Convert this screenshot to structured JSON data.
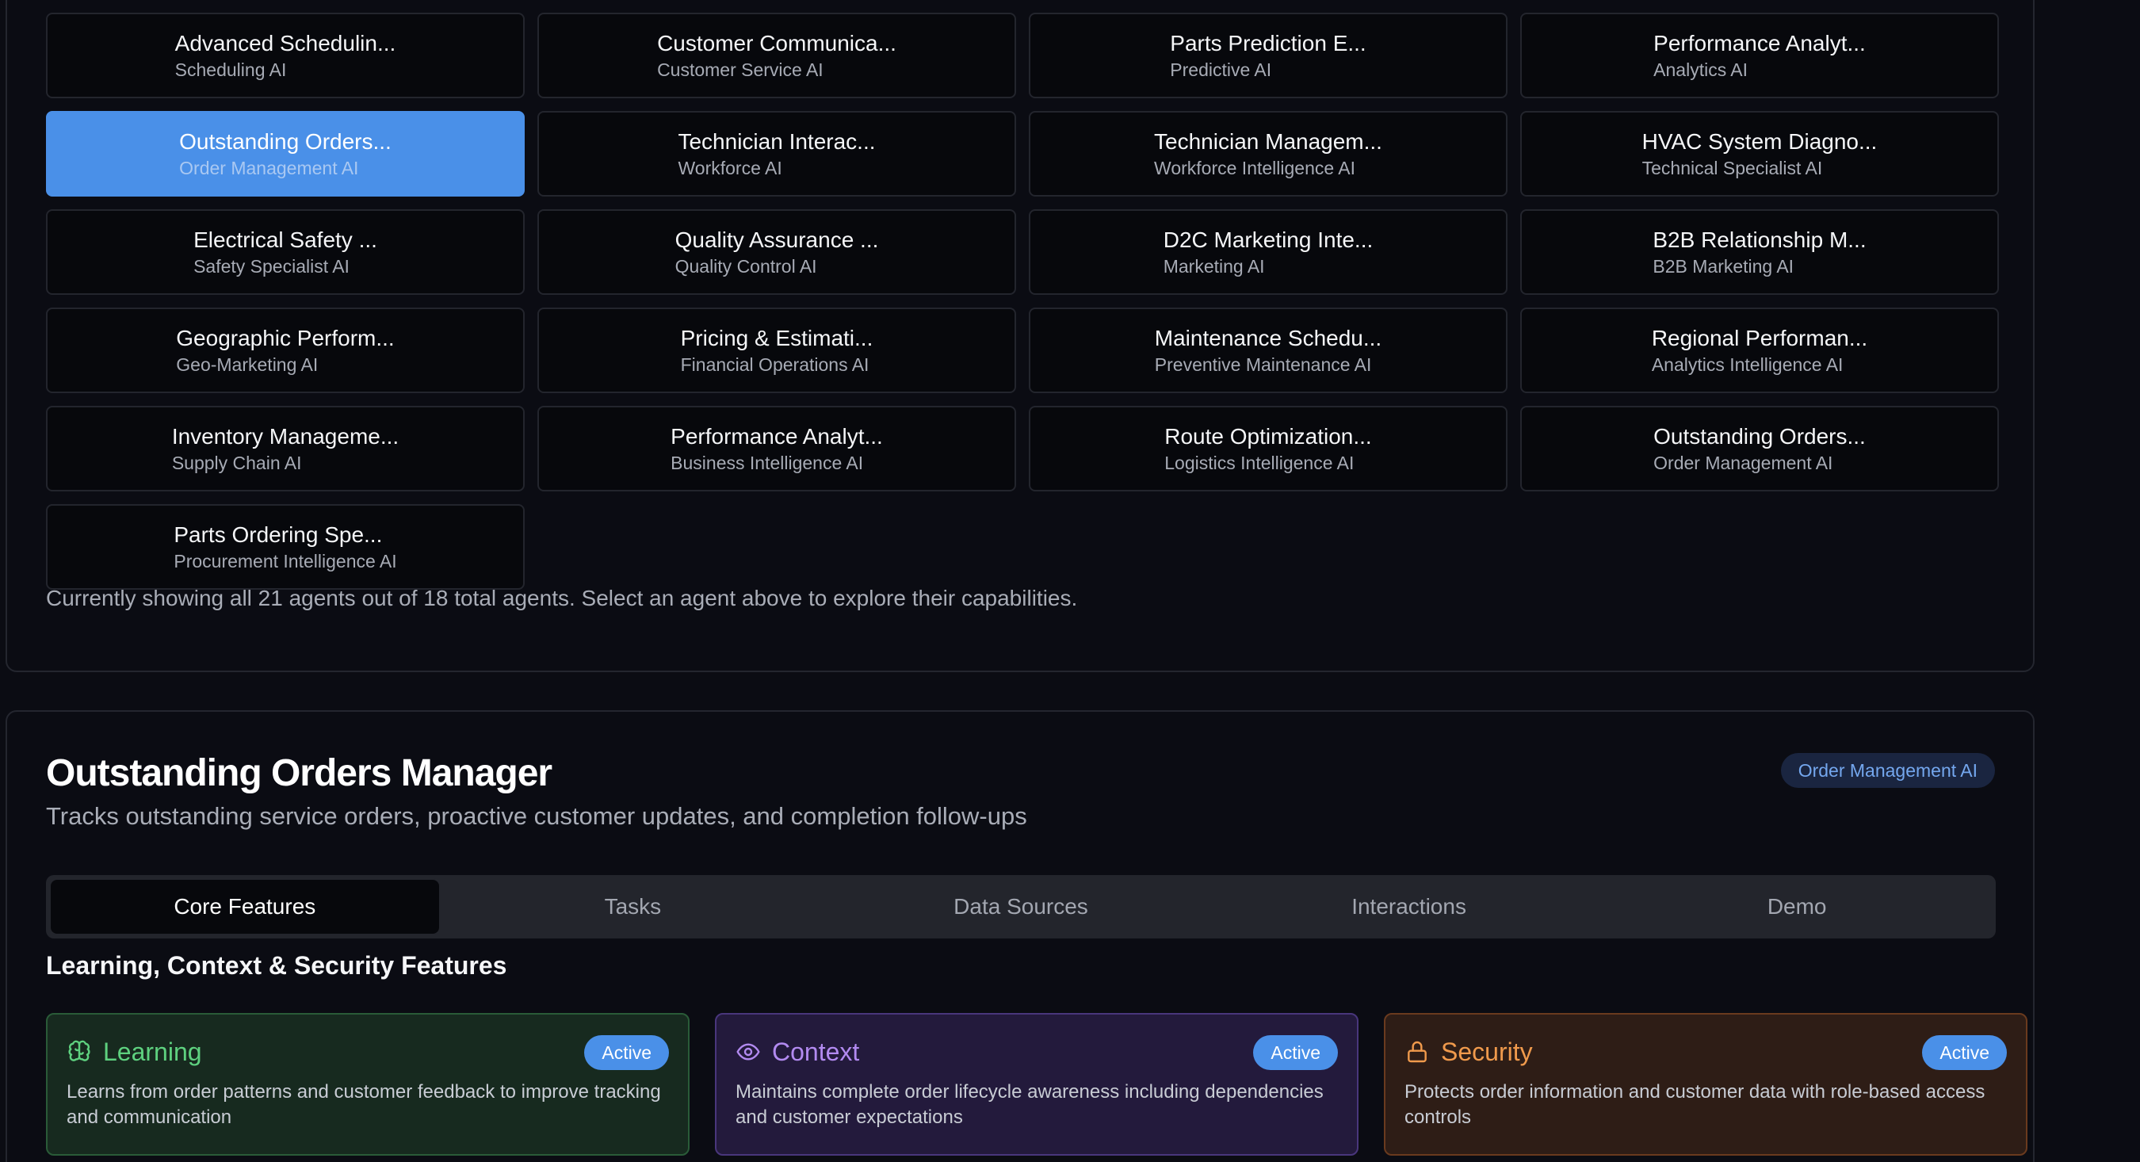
{
  "agents": [
    {
      "title": "Advanced Schedulin...",
      "subtitle": "Scheduling AI"
    },
    {
      "title": "Customer Communica...",
      "subtitle": "Customer Service AI"
    },
    {
      "title": "Parts Prediction E...",
      "subtitle": "Predictive AI"
    },
    {
      "title": "Performance Analyt...",
      "subtitle": "Analytics AI"
    },
    {
      "title": "Outstanding Orders...",
      "subtitle": "Order Management AI",
      "selected": true
    },
    {
      "title": "Technician Interac...",
      "subtitle": "Workforce AI"
    },
    {
      "title": "Technician Managem...",
      "subtitle": "Workforce Intelligence AI"
    },
    {
      "title": "HVAC System Diagno...",
      "subtitle": "Technical Specialist AI"
    },
    {
      "title": "Electrical Safety ...",
      "subtitle": "Safety Specialist AI"
    },
    {
      "title": "Quality Assurance ...",
      "subtitle": "Quality Control AI"
    },
    {
      "title": "D2C Marketing Inte...",
      "subtitle": "Marketing AI"
    },
    {
      "title": "B2B Relationship M...",
      "subtitle": "B2B Marketing AI"
    },
    {
      "title": "Geographic Perform...",
      "subtitle": "Geo-Marketing AI"
    },
    {
      "title": "Pricing & Estimati...",
      "subtitle": "Financial Operations AI"
    },
    {
      "title": "Maintenance Schedu...",
      "subtitle": "Preventive Maintenance AI"
    },
    {
      "title": "Regional Performan...",
      "subtitle": "Analytics Intelligence AI"
    },
    {
      "title": "Inventory Manageme...",
      "subtitle": "Supply Chain AI"
    },
    {
      "title": "Performance Analyt...",
      "subtitle": "Business Intelligence AI"
    },
    {
      "title": "Route Optimization...",
      "subtitle": "Logistics Intelligence AI"
    },
    {
      "title": "Outstanding Orders...",
      "subtitle": "Order Management AI"
    },
    {
      "title": "Parts Ordering Spe...",
      "subtitle": "Procurement Intelligence AI"
    }
  ],
  "grid_footer": "Currently showing all 21 agents out of 18 total agents. Select an agent above to explore their capabilities.",
  "detail": {
    "title": "Outstanding Orders Manager",
    "badge": "Order Management AI",
    "description": "Tracks outstanding service orders, proactive customer updates, and completion follow-ups",
    "tabs": [
      {
        "label": "Core Features",
        "active": true
      },
      {
        "label": "Tasks"
      },
      {
        "label": "Data Sources"
      },
      {
        "label": "Interactions"
      },
      {
        "label": "Demo"
      }
    ],
    "section_heading": "Learning, Context & Security Features",
    "features": [
      {
        "name": "Learning",
        "status": "Active",
        "icon": "brain-icon",
        "text": "Learns from order patterns and customer feedback to improve tracking and communication"
      },
      {
        "name": "Context",
        "status": "Active",
        "icon": "eye-icon",
        "text": "Maintains complete order lifecycle awareness including dependencies and customer expectations"
      },
      {
        "name": "Security",
        "status": "Active",
        "icon": "lock-icon",
        "text": "Protects order information and customer data with role-based access controls"
      }
    ]
  },
  "colors": {
    "background": "#0b0c13",
    "accent": "#4a90e8",
    "learning": "#5ed17f",
    "context": "#b28af0",
    "security": "#f09a4c"
  }
}
